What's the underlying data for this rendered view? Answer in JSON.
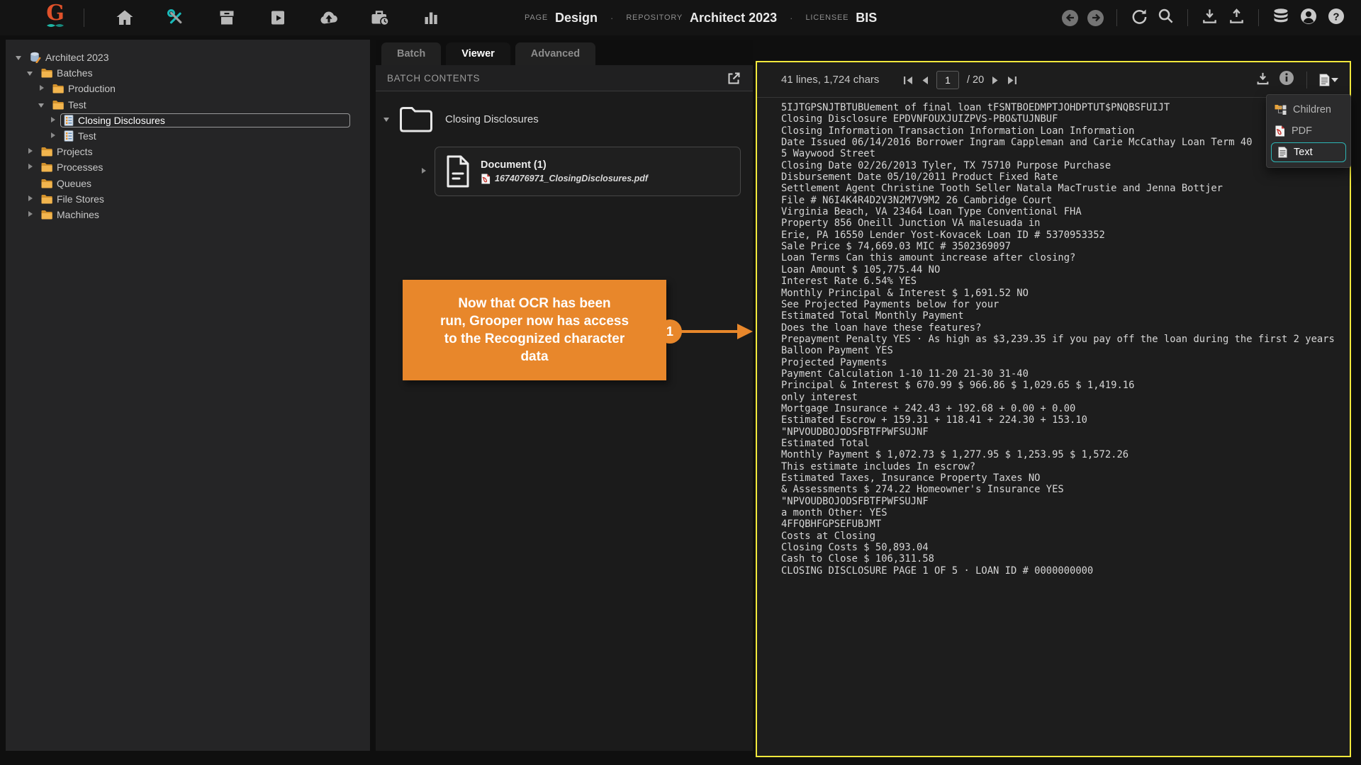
{
  "topbar": {
    "page_label": "PAGE",
    "page_value": "Design",
    "repo_label": "REPOSITORY",
    "repo_value": "Architect 2023",
    "licensee_label": "LICENSEE",
    "licensee_value": "BIS",
    "separator": "·"
  },
  "sidebar": {
    "tree": [
      {
        "label": "Architect 2023",
        "level": 0,
        "expander": "open",
        "icon": "repository",
        "selected": false
      },
      {
        "label": "Batches",
        "level": 1,
        "expander": "open",
        "icon": "folder",
        "selected": false
      },
      {
        "label": "Production",
        "level": 2,
        "expander": "closed",
        "icon": "folder",
        "selected": false
      },
      {
        "label": "Test",
        "level": 2,
        "expander": "open",
        "icon": "folder",
        "selected": false
      },
      {
        "label": "Closing Disclosures",
        "level": 3,
        "expander": "closed",
        "icon": "batch",
        "selected": true
      },
      {
        "label": "Test",
        "level": 3,
        "expander": "closed",
        "icon": "batch",
        "selected": false
      },
      {
        "label": "Projects",
        "level": 1,
        "expander": "closed",
        "icon": "folder",
        "selected": false
      },
      {
        "label": "Processes",
        "level": 1,
        "expander": "closed",
        "icon": "folder",
        "selected": false
      },
      {
        "label": "Queues",
        "level": 1,
        "expander": "none",
        "icon": "folder",
        "selected": false
      },
      {
        "label": "File Stores",
        "level": 1,
        "expander": "closed",
        "icon": "folder",
        "selected": false
      },
      {
        "label": "Machines",
        "level": 1,
        "expander": "closed",
        "icon": "folder",
        "selected": false
      }
    ]
  },
  "panel_tabs": [
    {
      "label": "Batch",
      "active": false
    },
    {
      "label": "Viewer",
      "active": true
    },
    {
      "label": "Advanced",
      "active": false
    }
  ],
  "batch_contents": {
    "title": "BATCH CONTENTS",
    "folder_label": "Closing Disclosures",
    "document_title": "Document (1)",
    "document_file": "1674076971_ClosingDisclosures.pdf"
  },
  "callout": {
    "lines": [
      "Now that OCR has been",
      "run, Grooper now has access",
      "to the Recognized character",
      "data"
    ],
    "step_number": "1",
    "color": "#e8872b"
  },
  "viewer": {
    "stats": "41 lines, 1,724 chars",
    "page_current": "1",
    "page_total": "/ 20",
    "border_color": "#f2e93c",
    "menu": {
      "items": [
        {
          "label": "Children",
          "icon": "children",
          "selected": false
        },
        {
          "label": "PDF",
          "icon": "pdf",
          "selected": false
        },
        {
          "label": "Text",
          "icon": "text",
          "selected": true
        }
      ]
    },
    "lines": [
      "5IJTGPSNJTBTUBUement of final loan tFSNTBOEDMPTJOHDPTUT$PNQBSFUIJT",
      "Closing Disclosure EPDVNFOUXJUIZPVS-PBO&TUJNBUF",
      "Closing Information Transaction Information Loan Information",
      "Date Issued 06/14/2016 Borrower Ingram Cappleman and Carie McCathay Loan Term 40",
      "5 Waywood Street",
      "Closing Date 02/26/2013 Tyler, TX 75710 Purpose Purchase",
      "Disbursement Date 05/10/2011 Product Fixed Rate",
      "Settlement Agent Christine Tooth Seller Natala MacTrustie and Jenna Bottjer",
      "File # N6I4K4R4D2V3N2M7V9M2 26 Cambridge Court",
      "Virginia Beach, VA 23464 Loan Type Conventional FHA",
      "Property 856 Oneill Junction VA malesuada in",
      "Erie, PA 16550 Lender Yost-Kovacek Loan ID # 5370953352",
      "Sale Price $ 74,669.03 MIC # 3502369097",
      "Loan Terms Can this amount increase after closing?",
      "Loan Amount $ 105,775.44 NO",
      "Interest Rate 6.54% YES",
      "Monthly Principal & Interest $ 1,691.52 NO",
      "See Projected Payments below for your",
      "Estimated Total Monthly Payment",
      "Does the loan have these features?",
      "Prepayment Penalty YES · As high as $3,239.35 if you pay off the loan during the first 2 years",
      "Balloon Payment YES",
      "Projected Payments",
      "Payment Calculation 1-10 11-20 21-30 31-40",
      "Principal & Interest $ 670.99 $ 966.86 $ 1,029.65 $ 1,419.16",
      "only interest",
      "Mortgage Insurance + 242.43 + 192.68 + 0.00 + 0.00",
      "Estimated Escrow + 159.31 + 118.41 + 224.30 + 153.10",
      "\"NPVOUDBOJODSFBTFPWFSUJNF",
      "Estimated Total",
      "Monthly Payment $ 1,072.73 $ 1,277.95 $ 1,253.95 $ 1,572.26",
      "This estimate includes In escrow?",
      "Estimated Taxes, Insurance Property Taxes NO",
      "& Assessments $ 274.22 Homeowner's Insurance YES",
      "\"NPVOUDBOJODSFBTFPWFSUJNF",
      "a month Other: YES",
      "4FFQBHFGPSEFUBJMT",
      "Costs at Closing",
      "Closing Costs $ 50,893.04",
      "Cash to Close $ 106,311.58",
      "CLOSING DISCLOSURE PAGE 1 OF 5 · LOAN ID # 0000000000"
    ]
  }
}
